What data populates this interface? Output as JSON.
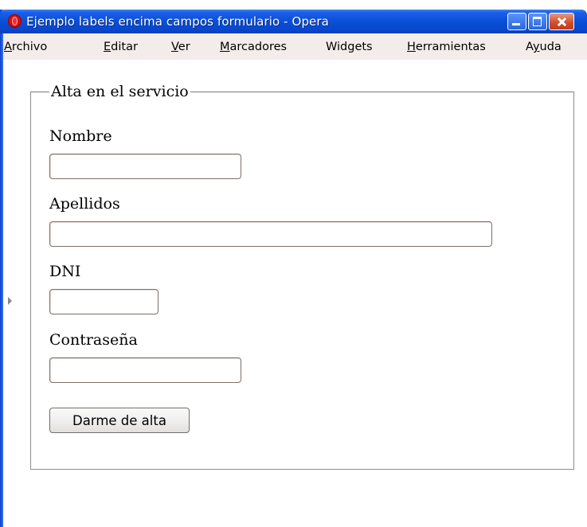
{
  "window": {
    "title": "Ejemplo labels encima campos formulario - Opera"
  },
  "menu": {
    "archivo": {
      "lead": "A",
      "rest": "rchivo"
    },
    "editar": {
      "lead": "E",
      "rest": "ditar"
    },
    "ver": {
      "lead": "V",
      "rest": "er"
    },
    "marcadores": {
      "lead": "M",
      "rest": "arcadores"
    },
    "widgets": {
      "lead": "",
      "rest": "Widgets"
    },
    "herramientas": {
      "lead": "H",
      "rest": "erramientas"
    },
    "ayuda": {
      "pre": "A",
      "u": "y",
      "post": "uda"
    }
  },
  "form": {
    "legend": "Alta en el servicio",
    "fields": {
      "nombre": {
        "label": "Nombre",
        "value": ""
      },
      "apellidos": {
        "label": "Apellidos",
        "value": ""
      },
      "dni": {
        "label": "DNI",
        "value": ""
      },
      "contrasena": {
        "label": "Contraseña",
        "value": ""
      }
    },
    "submit_label": "Darme de alta"
  }
}
